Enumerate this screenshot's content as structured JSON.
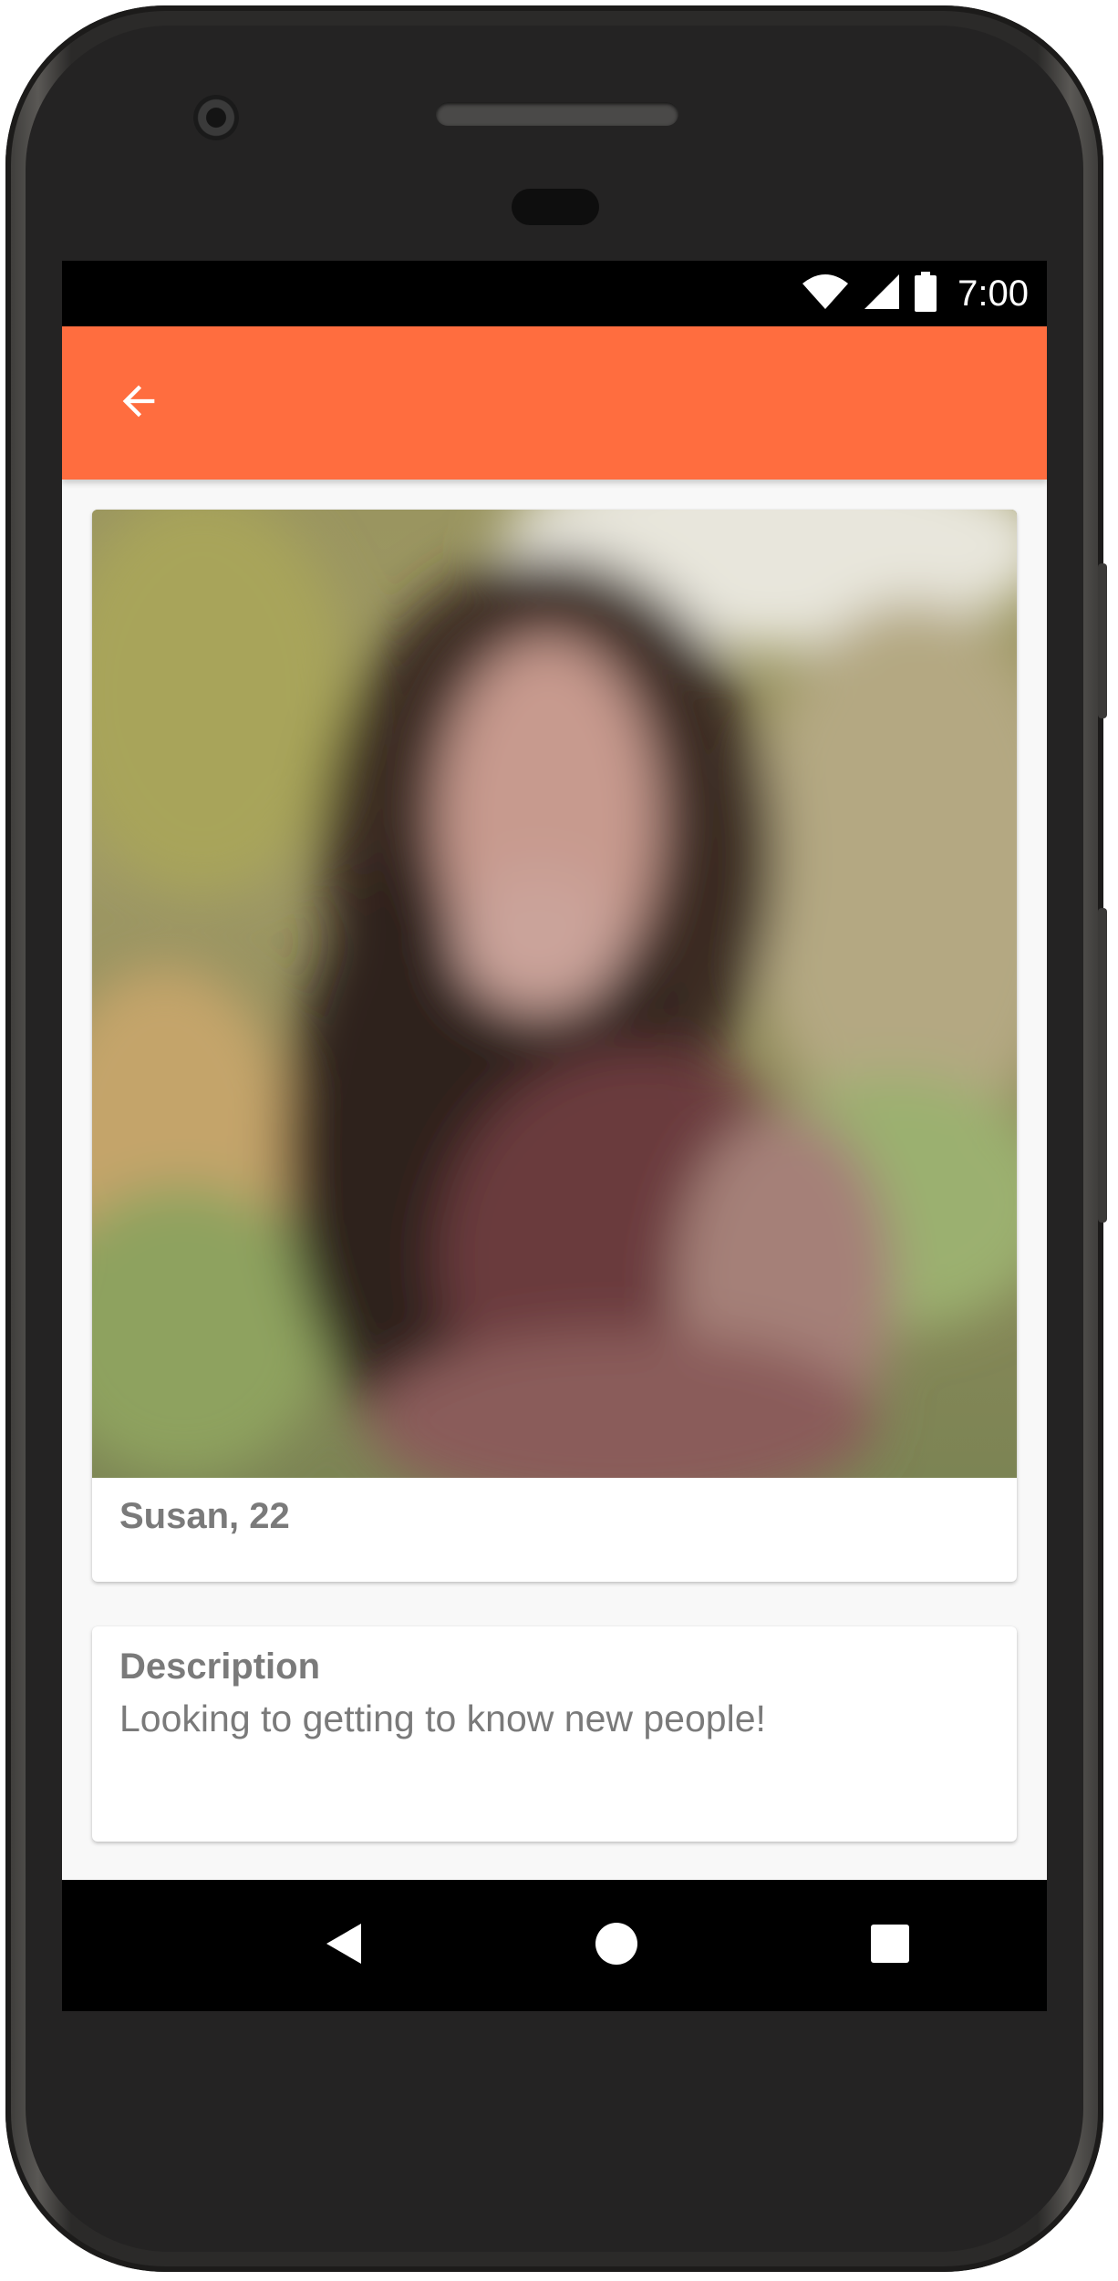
{
  "status_bar": {
    "time": "7:00",
    "icons": [
      "wifi-icon",
      "cellular-signal-icon",
      "battery-icon"
    ]
  },
  "app_bar": {
    "color": "#ff6d3f",
    "back_icon": "arrow-back-icon"
  },
  "profile": {
    "name_age": "Susan, 22",
    "photo": "profile-photo"
  },
  "description": {
    "title": "Description",
    "text": "Looking to getting to know new people!"
  },
  "nav_bar": {
    "icons": [
      "nav-back-icon",
      "nav-home-icon",
      "nav-recents-icon"
    ]
  },
  "colors": {
    "accent": "#ff6d3f",
    "text_secondary": "#7a7a7a",
    "background": "#f8f8f8"
  }
}
